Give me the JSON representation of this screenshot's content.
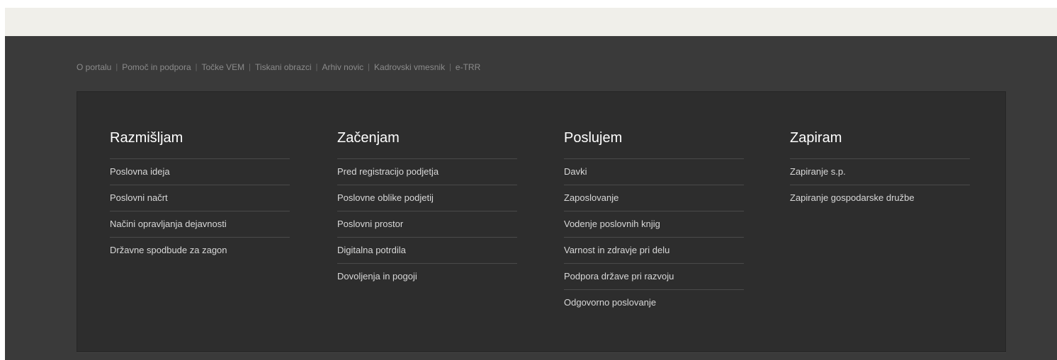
{
  "top_links": [
    "O portalu",
    "Pomoč in podpora",
    "Točke VEM",
    "Tiskani obrazci",
    "Arhiv novic",
    "Kadrovski vmesnik",
    "e-TRR"
  ],
  "columns": [
    {
      "title": "Razmišljam",
      "items": [
        "Poslovna ideja",
        "Poslovni načrt",
        "Načini opravljanja dejavnosti",
        "Državne spodbude za zagon"
      ]
    },
    {
      "title": "Začenjam",
      "items": [
        "Pred registracijo podjetja",
        "Poslovne oblike podjetij",
        "Poslovni prostor",
        "Digitalna potrdila",
        "Dovoljenja in pogoji"
      ]
    },
    {
      "title": "Poslujem",
      "items": [
        "Davki",
        "Zaposlovanje",
        "Vodenje poslovnih knjig",
        "Varnost in zdravje pri delu",
        "Podpora države pri razvoju",
        "Odgovorno poslovanje"
      ]
    },
    {
      "title": "Zapiram",
      "items": [
        "Zapiranje s.p.",
        "Zapiranje gospodarske družbe"
      ]
    }
  ]
}
